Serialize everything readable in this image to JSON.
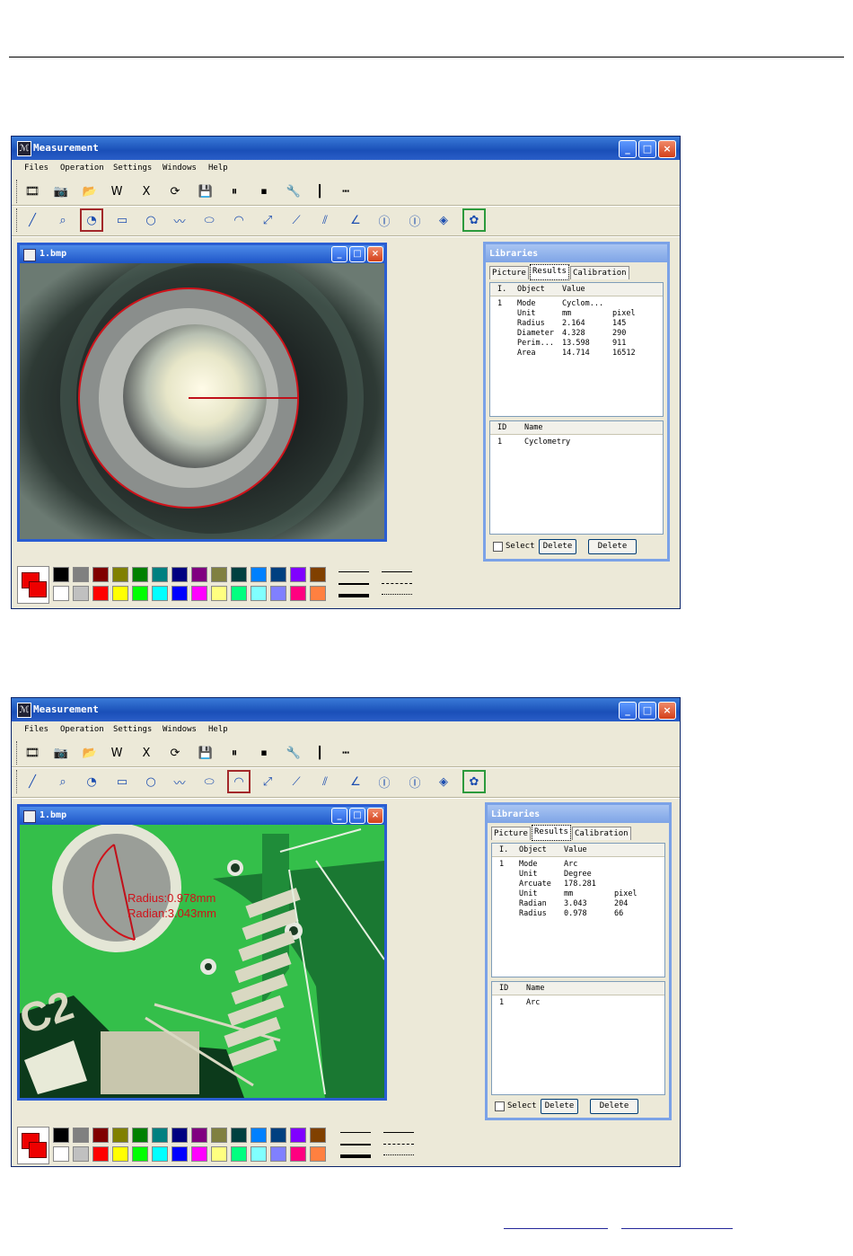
{
  "window": {
    "title": "Measurement",
    "minimize": "_",
    "maximize": "□",
    "close": "×"
  },
  "menu": {
    "items": [
      "Files",
      "Operation",
      "Settings",
      "Windows",
      "Help"
    ]
  },
  "toolbar1": [
    "film-icon",
    "camera-icon",
    "open-folder-icon",
    "word-icon",
    "excel-icon",
    "refresh-icon",
    "save-icon",
    "pause-icon",
    "stop-icon",
    "wrench-icon",
    "ruler-vertical-icon",
    "ruler-horizontal-icon"
  ],
  "toolbar2": [
    "line-tool-icon",
    "zoom-icon",
    "circle-three-point-icon",
    "rectangle-icon",
    "circle-icon",
    "polyline-icon",
    "ellipse-icon",
    "arc-icon",
    "point-to-point-icon",
    "point-line-icon",
    "parallel-lines-icon",
    "angle-icon",
    "vertical-measure-icon",
    "horizontal-measure-icon",
    "diamond-icon",
    "palette-icon"
  ],
  "toolbar2_glyphs": [
    "╱",
    "⌕",
    "◔",
    "▭",
    "○",
    "〰",
    "⬭",
    "◠",
    "⤢",
    "⟋",
    "⫽",
    "∠",
    "Ⓘ",
    "Ⓘ",
    "◈",
    "✿"
  ],
  "toolbar1_glyphs": [
    "🎞",
    "📷",
    "📂",
    "W",
    "X",
    "⟳",
    "💾",
    "⏸",
    "⏹",
    "🔧",
    "┃",
    "┅"
  ],
  "image_window": {
    "title": "1.bmp"
  },
  "libraries": {
    "title": "Libraries",
    "tabs": [
      "Picture",
      "Results",
      "Calibration"
    ],
    "results_header": {
      "id": "I.",
      "object": "Object",
      "value": "Value"
    },
    "list_header": {
      "id": "ID",
      "name": "Name"
    },
    "select_label": "Select",
    "delete_label_1": "Delete",
    "delete_label_2": "Delete"
  },
  "shot1": {
    "results": [
      {
        "id": "1",
        "object": "Mode",
        "value": "Cyclom...",
        "extra": ""
      },
      {
        "id": "",
        "object": "Unit",
        "value": "mm",
        "extra": "pixel"
      },
      {
        "id": "",
        "object": "Radius",
        "value": "2.164",
        "extra": "145"
      },
      {
        "id": "",
        "object": "Diameter",
        "value": "4.328",
        "extra": "290"
      },
      {
        "id": "",
        "object": "Perim...",
        "value": "13.598",
        "extra": "911"
      },
      {
        "id": "",
        "object": "Area",
        "value": "14.714",
        "extra": "16512"
      }
    ],
    "list": [
      {
        "id": "1",
        "name": "Cyclometry"
      }
    ]
  },
  "shot2": {
    "annotation": {
      "radius": "Radius:0.978mm",
      "radian": "Radian:3.043mm"
    },
    "results": [
      {
        "id": "1",
        "object": "Mode",
        "value": "Arc",
        "extra": ""
      },
      {
        "id": "",
        "object": "Unit",
        "value": "Degree",
        "extra": ""
      },
      {
        "id": "",
        "object": "Arcuate",
        "value": "178.281",
        "extra": ""
      },
      {
        "id": "",
        "object": "Unit",
        "value": "mm",
        "extra": "pixel"
      },
      {
        "id": "",
        "object": "Radian",
        "value": "3.043",
        "extra": "204"
      },
      {
        "id": "",
        "object": "Radius",
        "value": "0.978",
        "extra": "66"
      }
    ],
    "list": [
      {
        "id": "1",
        "name": "Arc"
      }
    ]
  },
  "palette": {
    "top": [
      "#000000",
      "#808080",
      "#800000",
      "#808000",
      "#008000",
      "#008080",
      "#000080",
      "#800080",
      "#808040",
      "#004040",
      "#0080ff",
      "#004080",
      "#8000ff",
      "#804000"
    ],
    "bottom": [
      "#ffffff",
      "#c0c0c0",
      "#ff0000",
      "#ffff00",
      "#00ff00",
      "#00ffff",
      "#0000ff",
      "#ff00ff",
      "#ffff80",
      "#00ff80",
      "#80ffff",
      "#8080ff",
      "#ff0080",
      "#ff8040"
    ]
  },
  "colors": {
    "selected_tool": "#a3282a",
    "palette_tool_selected": "#2c9a3c",
    "measure_line": "#d0121a"
  }
}
